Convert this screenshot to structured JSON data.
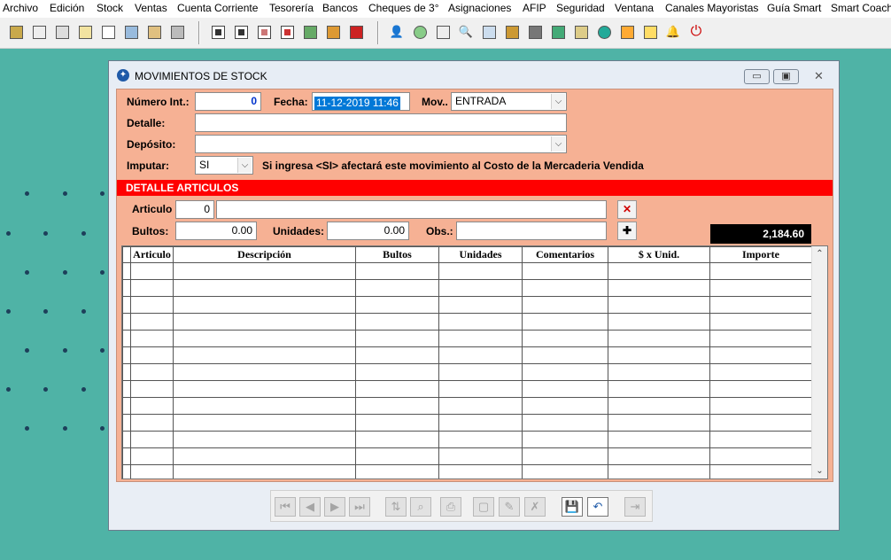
{
  "menu": [
    "Archivo",
    "Edición",
    "Stock",
    "Ventas",
    "Cuenta Corriente",
    "Tesorería",
    "Bancos",
    "Cheques de 3°",
    "Asignaciones",
    "AFIP",
    "Seguridad",
    "Ventana",
    "Canales Mayoristas",
    "Guía Smart",
    "Smart Coach"
  ],
  "window": {
    "title": "MOVIMIENTOS DE STOCK",
    "controls": {
      "minimize": "▭",
      "maximize": "▣",
      "close": "✕"
    }
  },
  "form": {
    "numero_label": "Número Int.:",
    "numero_value": "0",
    "fecha_label": "Fecha:",
    "fecha_value": "11-12-2019 11:46",
    "mov_label": "Mov..",
    "mov_value": "ENTRADA",
    "detalle_label": "Detalle:",
    "detalle_value": "",
    "deposito_label": "Depósito:",
    "deposito_value": "",
    "imputar_label": "Imputar:",
    "imputar_value": "SI",
    "imputar_note": "Si ingresa <SI> afectará este movimiento al Costo de la Mercaderia Vendida"
  },
  "detalle": {
    "header": "DETALLE ARTICULOS",
    "articulo_label": "Articulo",
    "articulo_code": "0",
    "articulo_desc": "",
    "bultos_label": "Bultos:",
    "bultos_value": "0.00",
    "unidades_label": "Unidades:",
    "unidades_value": "0.00",
    "obs_label": "Obs.:",
    "obs_value": "",
    "total": "2,184.60"
  },
  "grid": {
    "columns": [
      "Articulo",
      "Descripción",
      "Bultos",
      "Unidades",
      "Comentarios",
      "$ x Unid.",
      "Importe"
    ]
  },
  "colors": {
    "desktop": "#4fb3a6",
    "form_bg": "#f6b194",
    "header_red": "#ff0000",
    "selection": "#0078d7"
  },
  "icons": {
    "delete_row": "x-icon",
    "add_row": "plus-icon"
  }
}
